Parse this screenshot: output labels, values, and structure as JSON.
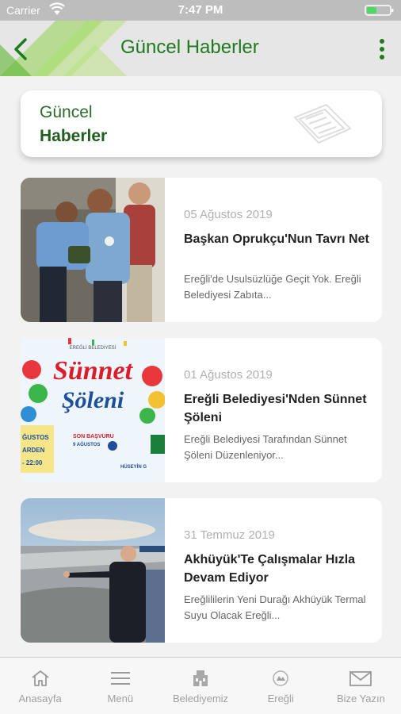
{
  "status_bar": {
    "carrier": "Carrier",
    "time": "7:47 PM"
  },
  "nav": {
    "title": "Güncel Haberler"
  },
  "header_card": {
    "line1": "Güncel",
    "line2": "Haberler"
  },
  "news": [
    {
      "date": "05 Ağustos 2019",
      "title": "Başkan Oprukçu'Nun Tavrı Net",
      "summary": "Ereğli'de Usulsüzlüğe Geçit Yok. Ereğli Belediyesi Zabıta..."
    },
    {
      "date": "01 Ağustos 2019",
      "title": "Ereğli Belediyesi'Nden Sünnet Şöleni",
      "summary": "Ereğli Belediyesi Tarafından Sünnet Şöleni Düzenleniyor..."
    },
    {
      "date": "31 Temmuz 2019",
      "title": "Akhüyük'Te Çalışmalar Hızla Devam Ediyor",
      "summary": "Ereğlililerin Yeni Durağı Akhüyük Termal Suyu Olacak Ereğli..."
    }
  ],
  "poster": {
    "org": "EREĞLİ BELEDİYESİ",
    "line1": "Sünnet",
    "line2": "Şöleni",
    "deadline_label": "SON BAŞVURU",
    "deadline_date": "9 AĞUSTOS",
    "left_frag1": "ĞUSTOS",
    "left_frag2": "ARDEN",
    "left_frag3": "- 22:00",
    "right_frag": "HÜSEYİN G"
  },
  "tabs": [
    {
      "label": "Anasayfa",
      "icon": "home-icon"
    },
    {
      "label": "Menü",
      "icon": "menu-icon"
    },
    {
      "label": "Belediyemiz",
      "icon": "building-icon"
    },
    {
      "label": "Ereğli",
      "icon": "city-icon"
    },
    {
      "label": "Bize Yazın",
      "icon": "mail-icon"
    }
  ],
  "colors": {
    "accent": "#1e7a1e",
    "nav_bg": "#e6e6e6",
    "page_bg": "#f2f2f2",
    "status_bg": "#bdbdbd"
  }
}
